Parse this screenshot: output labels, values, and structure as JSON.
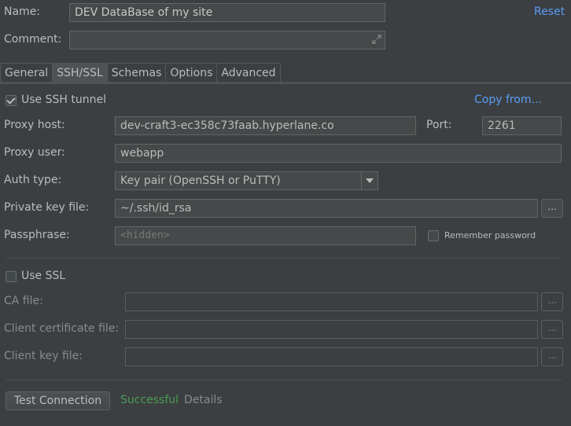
{
  "header": {
    "name_label": "Name:",
    "name_value": "DEV DataBase of my site",
    "reset_link": "Reset",
    "comment_label": "Comment:",
    "comment_value": ""
  },
  "tabs": [
    {
      "label": "General",
      "active": false
    },
    {
      "label": "SSH/SSL",
      "active": true
    },
    {
      "label": "Schemas",
      "active": false
    },
    {
      "label": "Options",
      "active": false
    },
    {
      "label": "Advanced",
      "active": false
    }
  ],
  "ssh": {
    "use_ssh_label": "Use SSH tunnel",
    "use_ssh_checked": true,
    "copy_from_link": "Copy from...",
    "proxy_host_label": "Proxy host:",
    "proxy_host_value": "dev-craft3-ec358c73faab.hyperlane.co",
    "port_label": "Port:",
    "port_value": "2261",
    "proxy_user_label": "Proxy user:",
    "proxy_user_value": "webapp",
    "auth_type_label": "Auth type:",
    "auth_type_value": "Key pair (OpenSSH or PuTTY)",
    "private_key_label": "Private key file:",
    "private_key_value": "~/.ssh/id_rsa",
    "passphrase_label": "Passphrase:",
    "passphrase_placeholder": "<hidden>",
    "remember_password_label": "Remember password",
    "browse_label": "..."
  },
  "ssl": {
    "use_ssl_label": "Use SSL",
    "use_ssl_checked": false,
    "ca_file_label": "CA file:",
    "client_cert_label": "Client certificate file:",
    "client_key_label": "Client key file:"
  },
  "footer": {
    "test_button": "Test Connection",
    "status": "Successful",
    "details_link": "Details"
  }
}
